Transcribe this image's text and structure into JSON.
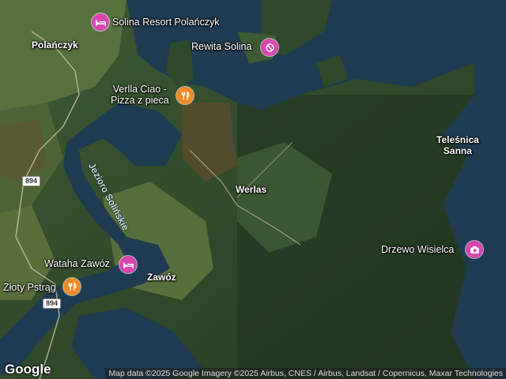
{
  "places": {
    "polanczyk": "Polańczyk",
    "werlas": "Werlas",
    "zawoz": "Zawóz",
    "telesnica_1": "Teleśnica",
    "telesnica_2": "Sanna"
  },
  "pois": {
    "solina_resort": "Solina Resort Polańczyk",
    "rewita": "Rewita Solina",
    "verlla_1": "Verlla Ciao -",
    "verlla_2": "Pizza z pieca",
    "wataha": "Wataha Zawóz",
    "zloty": "Złoty Pstrąg",
    "drzewo": "Drzewo Wisielca"
  },
  "water": {
    "lake_name": "Jezioro Solińskie"
  },
  "roads": {
    "r1": "894",
    "r2": "894"
  },
  "footer": {
    "logo": "Google",
    "attribution": "Map data ©2025 Google Imagery ©2025 Airbus, CNES / Airbus, Landsat / Copernicus, Maxar Technologies"
  },
  "colors": {
    "hotel_marker": "#d946b0",
    "food_marker": "#f08a24",
    "attraction_marker": "#d946b0",
    "water": "#1f3c52",
    "forest": "#2e4a2a"
  },
  "icons": {
    "hotel": "bed-icon",
    "food": "fork-knife-icon",
    "camera": "camera-icon",
    "leisure": "no-entry-icon"
  }
}
